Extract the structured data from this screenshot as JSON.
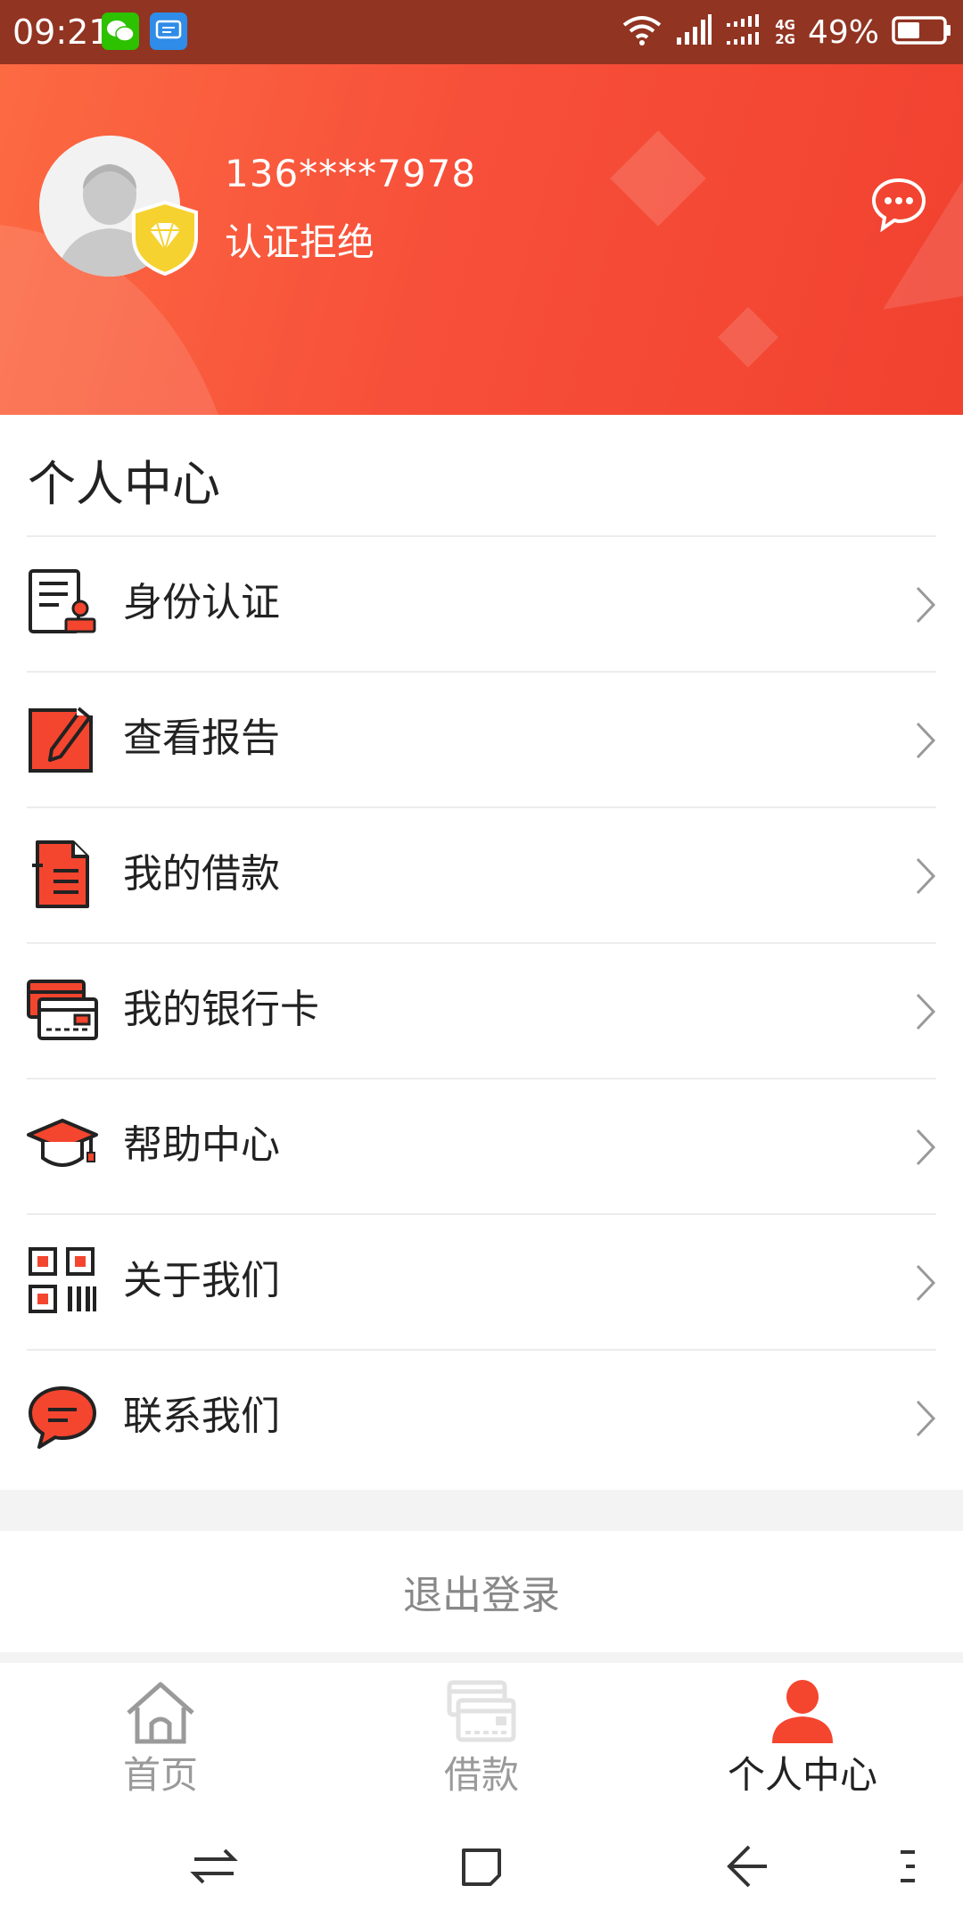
{
  "status_bar": {
    "time": "09:21",
    "battery_percent": "49%",
    "network_top": "4G",
    "network_bottom": "2G",
    "battery_level": 0.49
  },
  "profile": {
    "phone": "136****7978",
    "cert_status": "认证拒绝"
  },
  "section_title": "个人中心",
  "menu": [
    {
      "label": "身份认证",
      "icon": "id-card-stamp-icon"
    },
    {
      "label": "查看报告",
      "icon": "report-edit-icon"
    },
    {
      "label": "我的借款",
      "icon": "loan-document-icon"
    },
    {
      "label": "我的银行卡",
      "icon": "bank-card-icon"
    },
    {
      "label": "帮助中心",
      "icon": "graduation-cap-icon"
    },
    {
      "label": "关于我们",
      "icon": "qr-code-icon"
    },
    {
      "label": "联系我们",
      "icon": "chat-bubble-icon"
    }
  ],
  "logout_label": "退出登录",
  "tabs": [
    {
      "label": "首页",
      "icon": "home-icon",
      "active": false
    },
    {
      "label": "借款",
      "icon": "card-stack-icon",
      "active": false
    },
    {
      "label": "个人中心",
      "icon": "person-icon",
      "active": true
    }
  ],
  "colors": {
    "accent": "#f4452f",
    "status_bar": "#913422",
    "text_dark": "#222222",
    "text_muted": "#9a9a9a"
  }
}
